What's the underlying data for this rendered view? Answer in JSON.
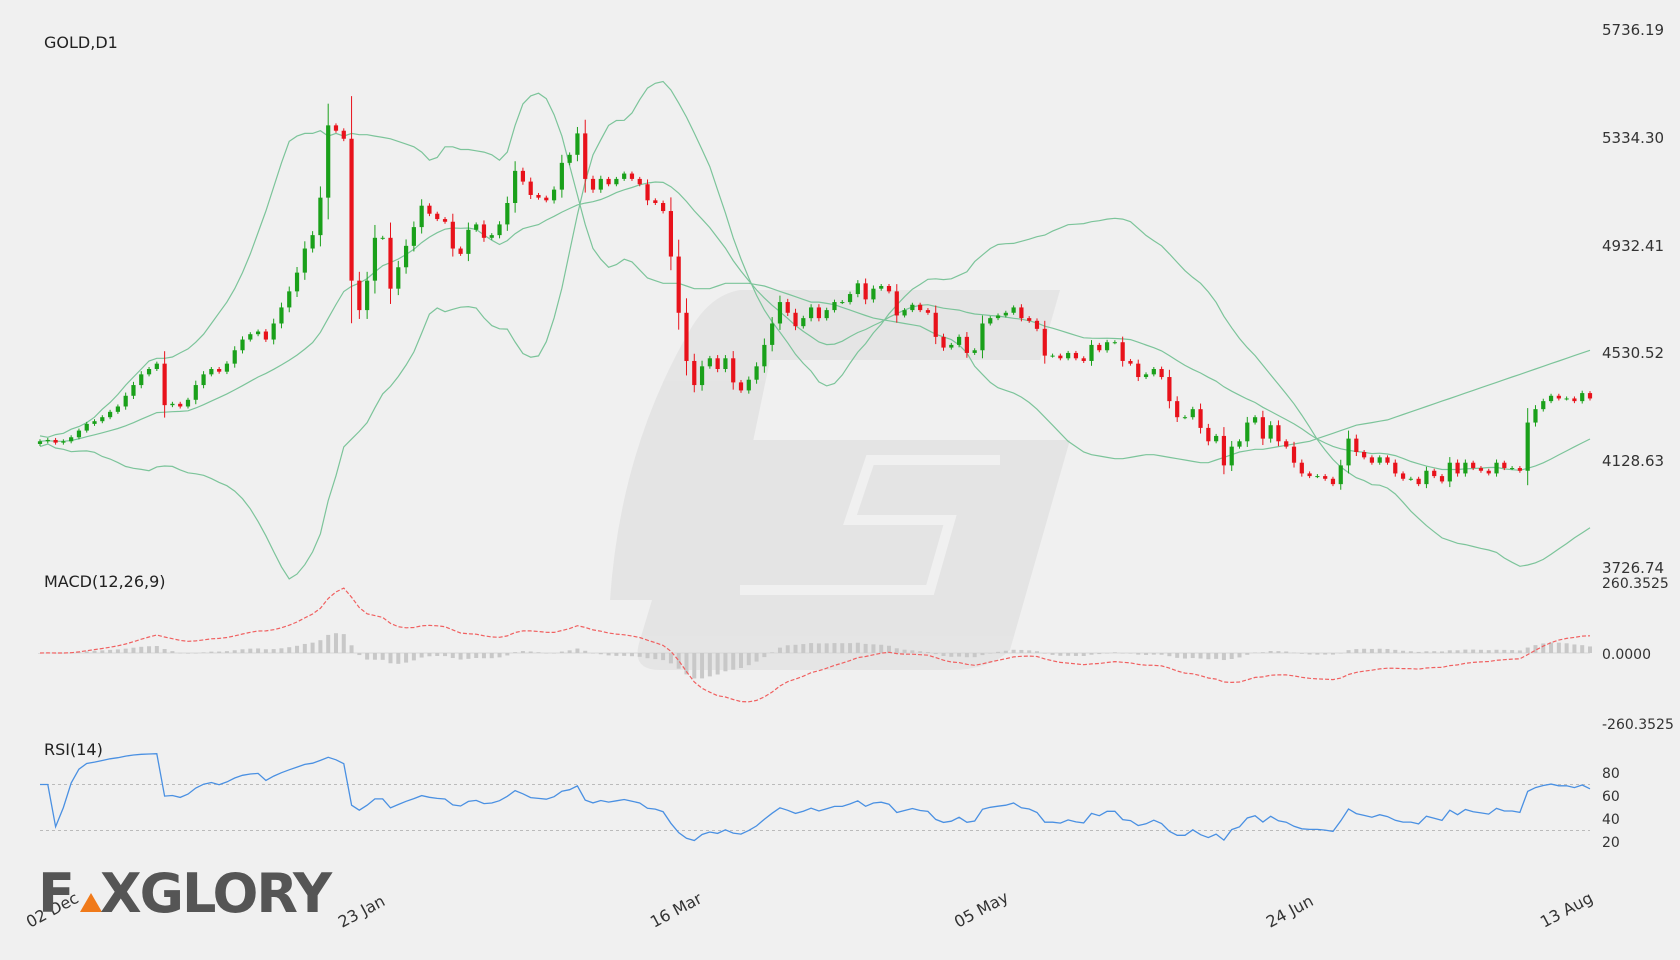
{
  "colors": {
    "bull": "#1aa01a",
    "bear": "#e8121b",
    "band": "#7cc49a",
    "macd_line": "#f06060",
    "macd_hist": "#c8c8c8",
    "rsi_line": "#4a90e2",
    "grid_dash": "#bbbbbb",
    "watermark": "#dddddd",
    "brand": "#555555",
    "brand_accent": "#f07a1a"
  },
  "price_panel": {
    "title": "GOLD,D1",
    "y_ticks": [
      "5736.19",
      "5334.30",
      "4932.41",
      "4530.52",
      "4128.63",
      "3726.74"
    ],
    "y_range": [
      3726.74,
      5736.19
    ]
  },
  "macd_panel": {
    "title": "MACD(12,26,9)",
    "y_ticks": [
      "260.3525",
      "0.0000",
      "-260.3525"
    ],
    "y_range": [
      -260.3525,
      260.3525
    ]
  },
  "rsi_panel": {
    "title": "RSI(14)",
    "y_ticks": [
      "80",
      "60",
      "40",
      "20"
    ],
    "levels": [
      70,
      30
    ]
  },
  "x_axis": {
    "labels": [
      "02 Dec",
      "23 Jan",
      "16 Mar",
      "05 May",
      "24 Jun",
      "13 Aug"
    ],
    "label_bar_index": [
      0,
      40,
      80,
      119,
      159,
      199
    ]
  },
  "brand": {
    "text_left": "F",
    "text_right": "XGLORY",
    "icon": "fxglory-logo-icon"
  },
  "watermark": {
    "icon": "fxglory-watermark-icon"
  },
  "chart_data": {
    "type": "candlestick",
    "symbol": "GOLD",
    "timeframe": "D1",
    "close": [
      4200,
      4205,
      4195,
      4200,
      4215,
      4240,
      4265,
      4275,
      4290,
      4310,
      4330,
      4370,
      4410,
      4450,
      4470,
      4490,
      4335,
      4340,
      4330,
      4355,
      4410,
      4450,
      4470,
      4460,
      4490,
      4540,
      4580,
      4600,
      4610,
      4580,
      4640,
      4700,
      4760,
      4830,
      4920,
      4970,
      5110,
      5380,
      5360,
      5330,
      4800,
      4690,
      4800,
      4960,
      4960,
      4770,
      4850,
      4930,
      5000,
      5080,
      5050,
      5030,
      5020,
      4920,
      4900,
      4990,
      5010,
      4960,
      4970,
      5010,
      5090,
      5210,
      5170,
      5120,
      5110,
      5100,
      5140,
      5240,
      5270,
      5350,
      5180,
      5140,
      5180,
      5160,
      5180,
      5200,
      5180,
      5160,
      5100,
      5090,
      5060,
      4890,
      4680,
      4500,
      4410,
      4480,
      4510,
      4470,
      4510,
      4420,
      4390,
      4430,
      4480,
      4560,
      4640,
      4720,
      4680,
      4630,
      4660,
      4700,
      4660,
      4690,
      4720,
      4720,
      4750,
      4790,
      4730,
      4770,
      4780,
      4760,
      4670,
      4690,
      4710,
      4690,
      4680,
      4590,
      4550,
      4560,
      4590,
      4530,
      4540,
      4640,
      4660,
      4670,
      4680,
      4700,
      4660,
      4650,
      4620,
      4520,
      4520,
      4510,
      4530,
      4510,
      4500,
      4560,
      4540,
      4570,
      4570,
      4500,
      4490,
      4440,
      4450,
      4470,
      4440,
      4350,
      4290,
      4290,
      4320,
      4250,
      4200,
      4220,
      4110,
      4180,
      4200,
      4270,
      4290,
      4210,
      4260,
      4200,
      4180,
      4120,
      4080,
      4070,
      4070,
      4060,
      4040,
      4110,
      4210,
      4160,
      4140,
      4120,
      4140,
      4120,
      4080,
      4060,
      4060,
      4040,
      4090,
      4070,
      4050,
      4120,
      4080,
      4120,
      4100,
      4090,
      4080,
      4120,
      4100,
      4100,
      4090,
      4270,
      4320,
      4350,
      4370,
      4360,
      4360,
      4350,
      4380,
      4360
    ],
    "bollinger_upper": [
      4220,
      4215,
      4225,
      4230,
      4245,
      4255,
      4270,
      4290,
      4320,
      4345,
      4375,
      4410,
      4440,
      4470,
      4500,
      4510,
      4510,
      4515,
      4530,
      4545,
      4570,
      4600,
      4640,
      4680,
      4720,
      4770,
      4830,
      4900,
      4980,
      5060,
      5150,
      5240,
      5320,
      5340,
      5350,
      5350,
      5360,
      5340,
      5350,
      5340,
      5350,
      5345,
      5345,
      5340,
      5335,
      5330,
      5320,
      5310,
      5300,
      5280,
      5250,
      5260,
      5300,
      5300,
      5290,
      5290,
      5285,
      5280,
      5270,
      5250,
      5280,
      5380,
      5460,
      5490,
      5500,
      5480,
      5420,
      5340,
      5230,
      5120,
      5010,
      4920,
      4880,
      4850,
      4860,
      4880,
      4870,
      4840,
      4810,
      4800,
      4790,
      4790,
      4790,
      4780,
      4770,
      4770,
      4770,
      4780,
      4790,
      4790,
      4790,
      4790,
      4785,
      4780,
      4770,
      4760,
      4750,
      4740,
      4730,
      4720,
      4720,
      4715,
      4710,
      4700,
      4690,
      4680,
      4670,
      4660,
      4655,
      4650,
      4645,
      4640,
      4635,
      4630,
      4615,
      4600,
      4590,
      4580,
      4560,
      4530,
      4480,
      4450,
      4420,
      4400,
      4390,
      4380,
      4365,
      4345,
      4320,
      4290,
      4260,
      4230,
      4200,
      4180,
      4160,
      4150,
      4145,
      4140,
      4135,
      4135,
      4140,
      4145,
      4150,
      4150,
      4145,
      4140,
      4135,
      4130,
      4125,
      4120,
      4120,
      4130,
      4140,
      4150,
      4160,
      4165,
      4170,
      4170,
      4175,
      4180,
      4185,
      4190,
      4195,
      4200,
      4210,
      4220,
      4230,
      4240,
      4250,
      4260,
      4265,
      4270,
      4275,
      4280,
      4290,
      4300,
      4310,
      4320,
      4330,
      4340,
      4350,
      4360,
      4370,
      4380,
      4390,
      4400,
      4410,
      4420,
      4430,
      4440,
      4450,
      4460,
      4470,
      4480,
      4490,
      4500,
      4510,
      4520,
      4530,
      4540
    ]
  }
}
